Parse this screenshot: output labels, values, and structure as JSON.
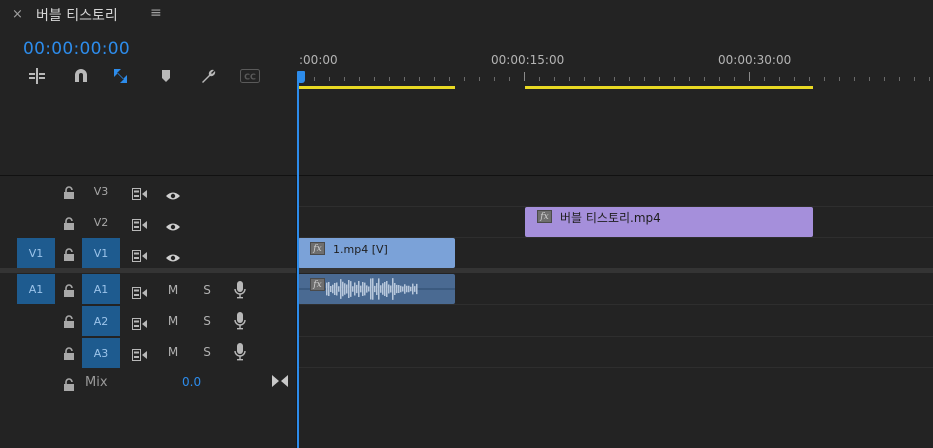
{
  "panel": {
    "close_glyph": "×",
    "title": "버블 티스토리",
    "menu_glyph": "≡"
  },
  "timecode": "00:00:00:00",
  "tools": [
    {
      "name": "insert-edit-icon"
    },
    {
      "name": "snap-magnet-icon"
    },
    {
      "name": "linked-selection-icon",
      "active": true
    },
    {
      "name": "add-marker-icon"
    },
    {
      "name": "timeline-settings-wrench-icon"
    },
    {
      "name": "captions-cc-icon",
      "label": "CC"
    }
  ],
  "ruler": {
    "labels": [
      "00:00",
      "00:00:15:00",
      "00:00:30:00"
    ],
    "partial_label": ":00:00"
  },
  "tracks": {
    "video": [
      {
        "label": "V3",
        "target": "",
        "active": false
      },
      {
        "label": "V2",
        "target": "",
        "active": false
      },
      {
        "label": "V1",
        "target": "V1",
        "active": true
      }
    ],
    "audio": [
      {
        "label": "A1",
        "target": "A1",
        "active": true,
        "m": "M",
        "s": "S"
      },
      {
        "label": "A2",
        "target": "",
        "active": true,
        "m": "M",
        "s": "S"
      },
      {
        "label": "A3",
        "target": "",
        "active": true,
        "m": "M",
        "s": "S"
      }
    ],
    "mix": {
      "label": "Mix",
      "value": "0.0"
    }
  },
  "clips": {
    "v2": {
      "name": "버블 티스토리.mp4",
      "fx": "fx",
      "color": "#a58fdb"
    },
    "v1": {
      "name": "1.mp4 [V]",
      "fx": "fx",
      "color": "#7ba2d8"
    },
    "a1": {
      "fx": "fx",
      "color": "#4a6a92"
    }
  },
  "colors": {
    "accent": "#2d8ceb",
    "target": "#1e5b8f",
    "workarea": "#e9d923"
  }
}
